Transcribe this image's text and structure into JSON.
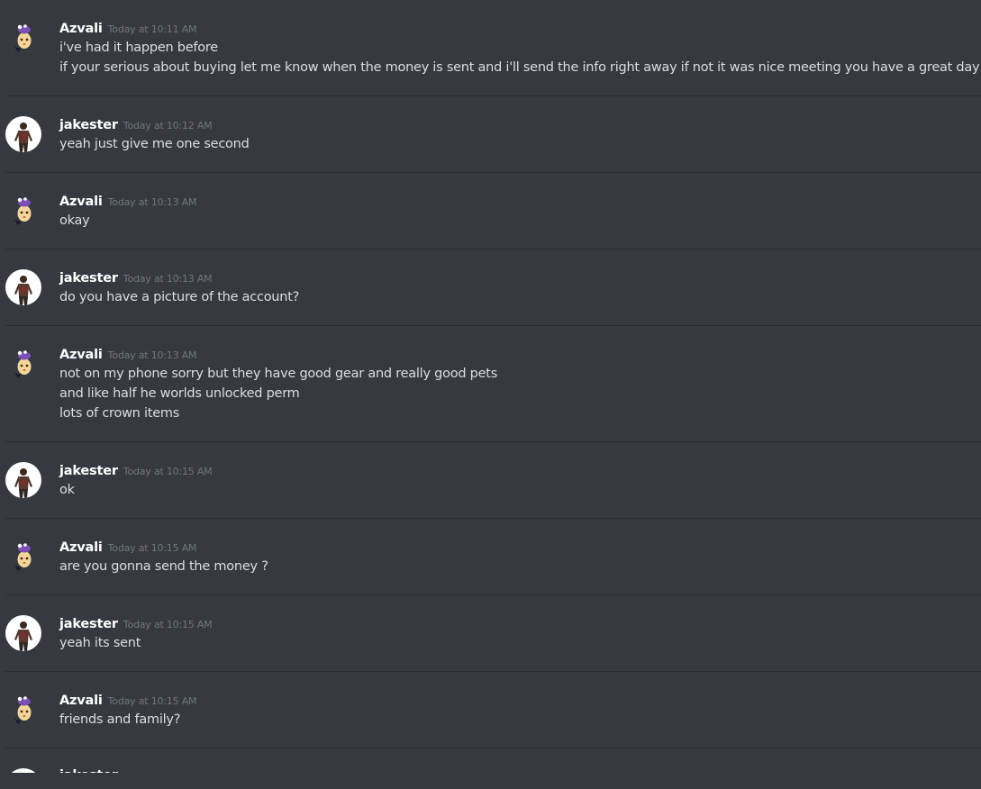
{
  "users": {
    "azvali": {
      "name": "Azvali",
      "avatar_icon": "purple-hat-character-icon",
      "avatar_bg": "#36393f"
    },
    "jakester": {
      "name": "jakester",
      "avatar_icon": "person-photo-icon",
      "avatar_bg": "#ffffff"
    }
  },
  "messages": [
    {
      "user": "Azvali",
      "timestamp": "Today at 10:11 AM",
      "lines": [
        "i've had it happen before",
        "if your serious about buying let me know when the money is sent and i'll send the info right away if not it was nice meeting you have a great day"
      ]
    },
    {
      "user": "jakester",
      "timestamp": "Today at 10:12 AM",
      "lines": [
        "yeah just give me one second"
      ]
    },
    {
      "user": "Azvali",
      "timestamp": "Today at 10:13 AM",
      "lines": [
        "okay"
      ]
    },
    {
      "user": "jakester",
      "timestamp": "Today at 10:13 AM",
      "lines": [
        "do you have a picture of the account?"
      ]
    },
    {
      "user": "Azvali",
      "timestamp": "Today at 10:13 AM",
      "lines": [
        "not on my phone sorry but they have good gear and really good pets",
        "and like half he worlds unlocked perm",
        "lots of crown items"
      ]
    },
    {
      "user": "jakester",
      "timestamp": "Today at 10:15 AM",
      "lines": [
        "ok"
      ]
    },
    {
      "user": "Azvali",
      "timestamp": "Today at 10:15 AM",
      "lines": [
        "are you gonna send the money ?"
      ]
    },
    {
      "user": "jakester",
      "timestamp": "Today at 10:15 AM",
      "lines": [
        "yeah its sent"
      ]
    },
    {
      "user": "Azvali",
      "timestamp": "Today at 10:15 AM",
      "lines": [
        "friends and family?"
      ]
    },
    {
      "user": "jakester",
      "timestamp": "",
      "lines": []
    }
  ],
  "colors": {
    "background": "#36393f",
    "username": "#ffffff",
    "timestamp": "#72767d",
    "message_text": "#dcddde",
    "divider": "#2a2c31"
  }
}
